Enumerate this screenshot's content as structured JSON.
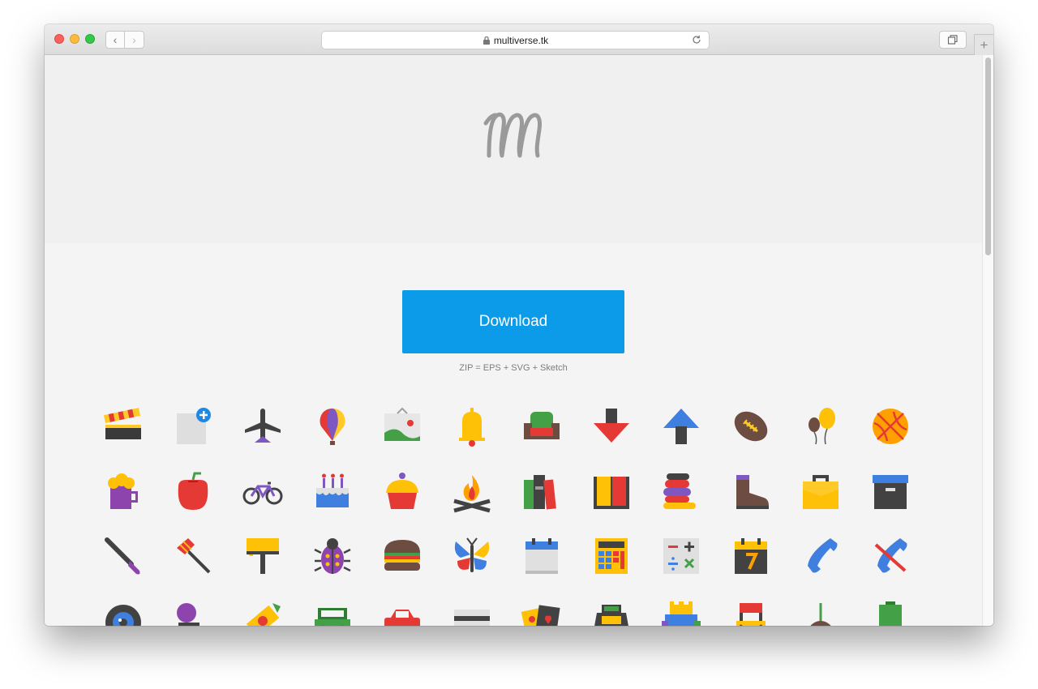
{
  "browser": {
    "url": "multiverse.tk",
    "back_glyph": "‹",
    "forward_glyph": "›",
    "new_tab_glyph": "+"
  },
  "hero": {
    "logo_icon": "multiverse-m-logo-icon"
  },
  "main": {
    "download_label": "Download",
    "formats_text": "ZIP = EPS + SVG + Sketch",
    "accent_color": "#0c9be8"
  },
  "icon_grid": {
    "rows": [
      [
        "clapperboard-icon",
        "add-document-icon",
        "airplane-icon",
        "hot-air-balloon-icon",
        "picture-icon",
        "bell-icon",
        "armchair-icon",
        "arrow-down-icon",
        "arrow-up-icon",
        "american-football-icon",
        "balloons-icon",
        "basketball-icon"
      ],
      [
        "beer-mug-icon",
        "bell-pepper-icon",
        "bicycle-icon",
        "birthday-cake-icon",
        "cupcake-icon",
        "campfire-icon",
        "books-icon",
        "open-book-icon",
        "stacked-books-icon",
        "boot-icon",
        "briefcase-icon",
        "archive-box-icon"
      ],
      [
        "paintbrush-icon",
        "broom-icon",
        "paint-roller-icon",
        "bug-icon",
        "burger-icon",
        "butterfly-icon",
        "calendar-icon",
        "calculator-icon",
        "math-operations-icon",
        "calendar-seven-icon",
        "phone-icon",
        "no-phone-icon"
      ],
      [
        "camera-lens-icon",
        "video-camera-icon",
        "candy-icon",
        "jeep-icon",
        "car-icon",
        "credit-card-icon",
        "playing-cards-icon",
        "cash-register-icon",
        "castle-icon",
        "director-chair-icon",
        "cherry-icon",
        "battery-icon"
      ]
    ]
  }
}
